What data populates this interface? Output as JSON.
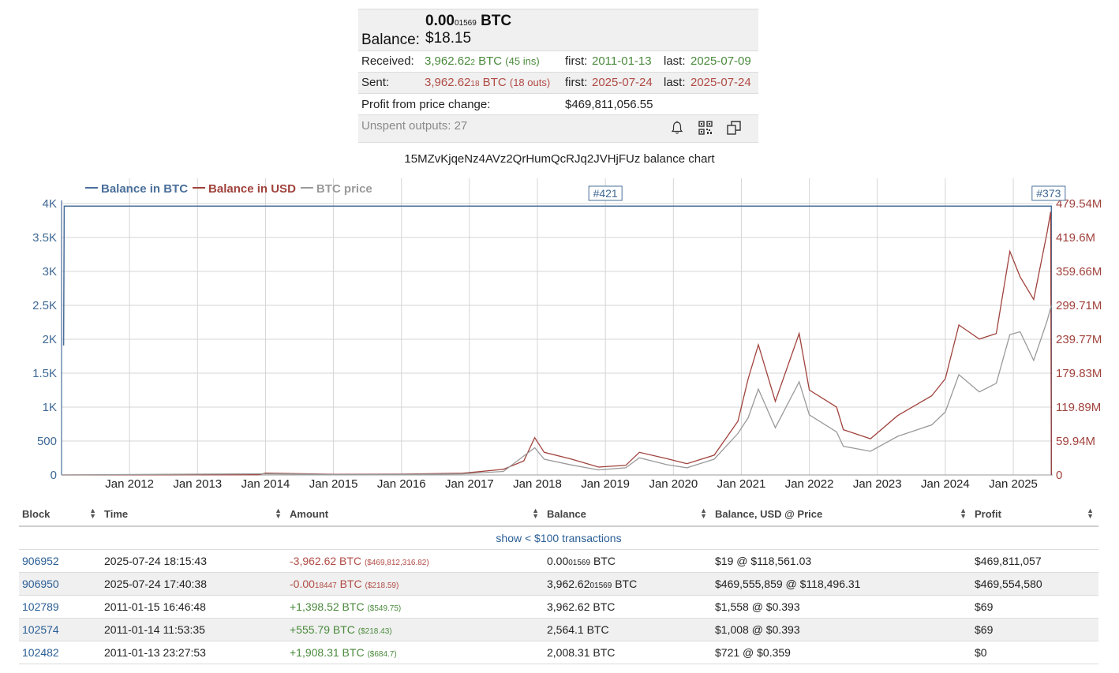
{
  "summary": {
    "balance_btc_main": "0.00",
    "balance_btc_small": "01569",
    "balance_unit": "BTC",
    "balance_label": "Balance:",
    "balance_usd": "$18.15",
    "received_label": "Received:",
    "received_main": "3,962.62",
    "received_small": "2",
    "received_unit": " BTC",
    "received_count": "(45 ins)",
    "received_first_label": "first:",
    "received_first": "2011-01-13",
    "received_last_label": "last:",
    "received_last": "2025-07-09",
    "sent_label": "Sent:",
    "sent_main": "3,962.62",
    "sent_small": "18",
    "sent_unit": " BTC",
    "sent_count": "(18 outs)",
    "sent_first_label": "first:",
    "sent_first": "2025-07-24",
    "sent_last_label": "last:",
    "sent_last": "2025-07-24",
    "profit_label": "Profit from price change:",
    "profit_value": "$469,811,056.55",
    "unspent_label": "Unspent outputs: 27",
    "icons": [
      "bell-icon",
      "qr-code-icon",
      "copy-icon"
    ]
  },
  "chart_title": "15MZvKjqeNz4AVz2QrHumQcRJq2JVHjFUz balance chart",
  "chart_data": {
    "type": "line",
    "legend": [
      {
        "name": "Balance in BTC",
        "color": "#4a6f9a"
      },
      {
        "name": "Balance in USD",
        "color": "#a0423c"
      },
      {
        "name": "BTC price",
        "color": "#9a9a9a"
      }
    ],
    "legend_position": "top-left",
    "grid": true,
    "x_ticks": [
      "Jan 2012",
      "Jan 2013",
      "Jan 2014",
      "Jan 2015",
      "Jan 2016",
      "Jan 2017",
      "Jan 2018",
      "Jan 2019",
      "Jan 2020",
      "Jan 2021",
      "Jan 2022",
      "Jan 2023",
      "Jan 2024",
      "Jan 2025"
    ],
    "x_range": [
      2011.0,
      2025.58
    ],
    "y_left_ticks": [
      "0",
      "500",
      "1K",
      "1.5K",
      "2K",
      "2.5K",
      "3K",
      "3.5K",
      "4K"
    ],
    "y_left_range": [
      0,
      4000
    ],
    "y_right_ticks": [
      "0",
      "59.94M",
      "119.89M",
      "179.83M",
      "239.77M",
      "299.71M",
      "359.66M",
      "419.6M",
      "479.54M"
    ],
    "y_right_range": [
      0,
      479540000
    ],
    "flags": [
      {
        "label": "#421",
        "x": 2019.0
      },
      {
        "label": "#373",
        "x": 2025.52
      }
    ],
    "series": [
      {
        "name": "Balance in BTC",
        "points": [
          [
            2011.03,
            1908
          ],
          [
            2011.04,
            3962
          ],
          [
            2025.56,
            3962
          ],
          [
            2025.56,
            0
          ]
        ]
      },
      {
        "name": "Balance in USD",
        "points": [
          [
            2011.0,
            0
          ],
          [
            2013.9,
            0.4
          ],
          [
            2014.0,
            3.3
          ],
          [
            2014.5,
            2.3
          ],
          [
            2015.0,
            1.2
          ],
          [
            2016.0,
            1.6
          ],
          [
            2016.9,
            3.0
          ],
          [
            2017.5,
            10
          ],
          [
            2017.8,
            25
          ],
          [
            2017.96,
            66
          ],
          [
            2018.1,
            40
          ],
          [
            2018.5,
            28
          ],
          [
            2018.9,
            14
          ],
          [
            2019.3,
            17
          ],
          [
            2019.5,
            40
          ],
          [
            2019.9,
            29
          ],
          [
            2020.2,
            20
          ],
          [
            2020.6,
            35
          ],
          [
            2020.95,
            95
          ],
          [
            2021.1,
            170
          ],
          [
            2021.25,
            230
          ],
          [
            2021.5,
            130
          ],
          [
            2021.85,
            250
          ],
          [
            2022.0,
            150
          ],
          [
            2022.4,
            120
          ],
          [
            2022.5,
            80
          ],
          [
            2022.9,
            64
          ],
          [
            2023.3,
            105
          ],
          [
            2023.8,
            140
          ],
          [
            2024.0,
            170
          ],
          [
            2024.2,
            265
          ],
          [
            2024.5,
            240
          ],
          [
            2024.75,
            250
          ],
          [
            2024.95,
            395
          ],
          [
            2025.1,
            350
          ],
          [
            2025.3,
            310
          ],
          [
            2025.5,
            430
          ],
          [
            2025.55,
            465
          ],
          [
            2025.56,
            0
          ]
        ]
      },
      {
        "name": "BTC price",
        "points": [
          [
            2011.0,
            0.3
          ],
          [
            2013.9,
            800
          ],
          [
            2014.5,
            600
          ],
          [
            2015.0,
            300
          ],
          [
            2016.0,
            400
          ],
          [
            2016.9,
            750
          ],
          [
            2017.5,
            2500
          ],
          [
            2017.96,
            19000
          ],
          [
            2018.1,
            11000
          ],
          [
            2018.5,
            7000
          ],
          [
            2018.9,
            3500
          ],
          [
            2019.3,
            5000
          ],
          [
            2019.5,
            12000
          ],
          [
            2019.9,
            7200
          ],
          [
            2020.2,
            5000
          ],
          [
            2020.6,
            11000
          ],
          [
            2020.95,
            29000
          ],
          [
            2021.1,
            40000
          ],
          [
            2021.25,
            60000
          ],
          [
            2021.5,
            33000
          ],
          [
            2021.85,
            65000
          ],
          [
            2022.0,
            42000
          ],
          [
            2022.4,
            30000
          ],
          [
            2022.5,
            20000
          ],
          [
            2022.9,
            16500
          ],
          [
            2023.3,
            27000
          ],
          [
            2023.8,
            35000
          ],
          [
            2024.0,
            44000
          ],
          [
            2024.2,
            70000
          ],
          [
            2024.5,
            58000
          ],
          [
            2024.75,
            64000
          ],
          [
            2024.95,
            98000
          ],
          [
            2025.1,
            100000
          ],
          [
            2025.3,
            80000
          ],
          [
            2025.5,
            108000
          ],
          [
            2025.56,
            118561
          ]
        ]
      }
    ]
  },
  "table": {
    "headers": [
      "Block",
      "Time",
      "Amount",
      "Balance",
      "Balance, USD @ Price",
      "Profit"
    ],
    "show_small": "show < $100 transactions",
    "rows": [
      {
        "block": "906952",
        "time": "2025-07-24 18:15:43",
        "amount": "-3,962.62 BTC",
        "amount_usd": "($469,812,316.82)",
        "amount_type": "red",
        "bal_main": "0.00",
        "bal_small": "01569",
        "bal_unit": " BTC",
        "usd_price": "$19 @ $118,561.03",
        "profit": "$469,811,057"
      },
      {
        "block": "906950",
        "time": "2025-07-24 17:40:38",
        "amount_main": "-0.00",
        "amount_small": "18447",
        "amount_unit": " BTC",
        "amount_usd": "($218.59)",
        "amount_type": "red",
        "bal_main": "3,962.62",
        "bal_small": "01569",
        "bal_unit": " BTC",
        "usd_price": "$469,555,859 @ $118,496.31",
        "profit": "$469,554,580"
      },
      {
        "block": "102789",
        "time": "2011-01-15 16:46:48",
        "amount": "+1,398.52 BTC",
        "amount_usd": "($549.75)",
        "amount_type": "green",
        "bal": "3,962.62 BTC",
        "usd_price": "$1,558 @ $0.393",
        "profit": "$69"
      },
      {
        "block": "102574",
        "time": "2011-01-14 11:53:35",
        "amount": "+555.79 BTC",
        "amount_usd": "($218.43)",
        "amount_type": "green",
        "bal": "2,564.1 BTC",
        "usd_price": "$1,008 @ $0.393",
        "profit": "$69"
      },
      {
        "block": "102482",
        "time": "2011-01-13 23:27:53",
        "amount": "+1,908.31 BTC",
        "amount_usd": "($684.7)",
        "amount_type": "green",
        "bal": "2,008.31 BTC",
        "usd_price": "$721 @ $0.359",
        "profit": "$0"
      }
    ]
  }
}
